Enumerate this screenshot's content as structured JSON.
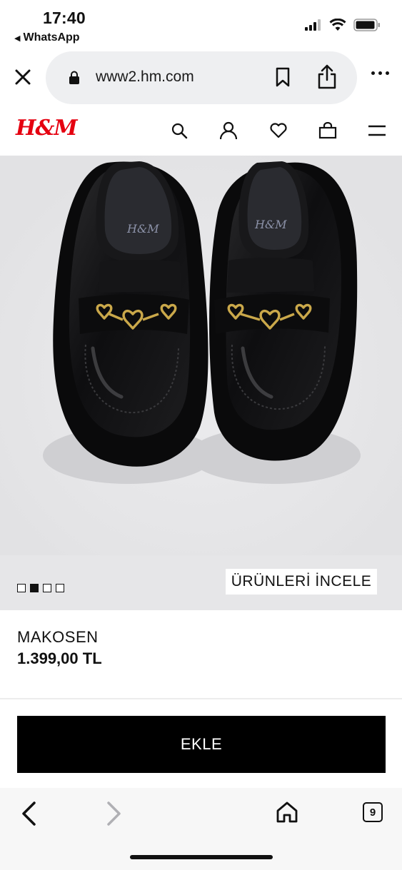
{
  "status_bar": {
    "time": "17:40",
    "back_app": "WhatsApp"
  },
  "browser": {
    "url": "www2.hm.com",
    "tab_count": "9"
  },
  "site": {
    "logo": "H&M",
    "brand_color": "#e50010"
  },
  "product": {
    "image_pages": 4,
    "active_image_index": 1,
    "review_button": "ÜRÜNLERİ İNCELE",
    "name": "MAKOSEN",
    "price": "1.399,00 TL",
    "add_button": "EKLE",
    "insole_logo": "H&M"
  }
}
